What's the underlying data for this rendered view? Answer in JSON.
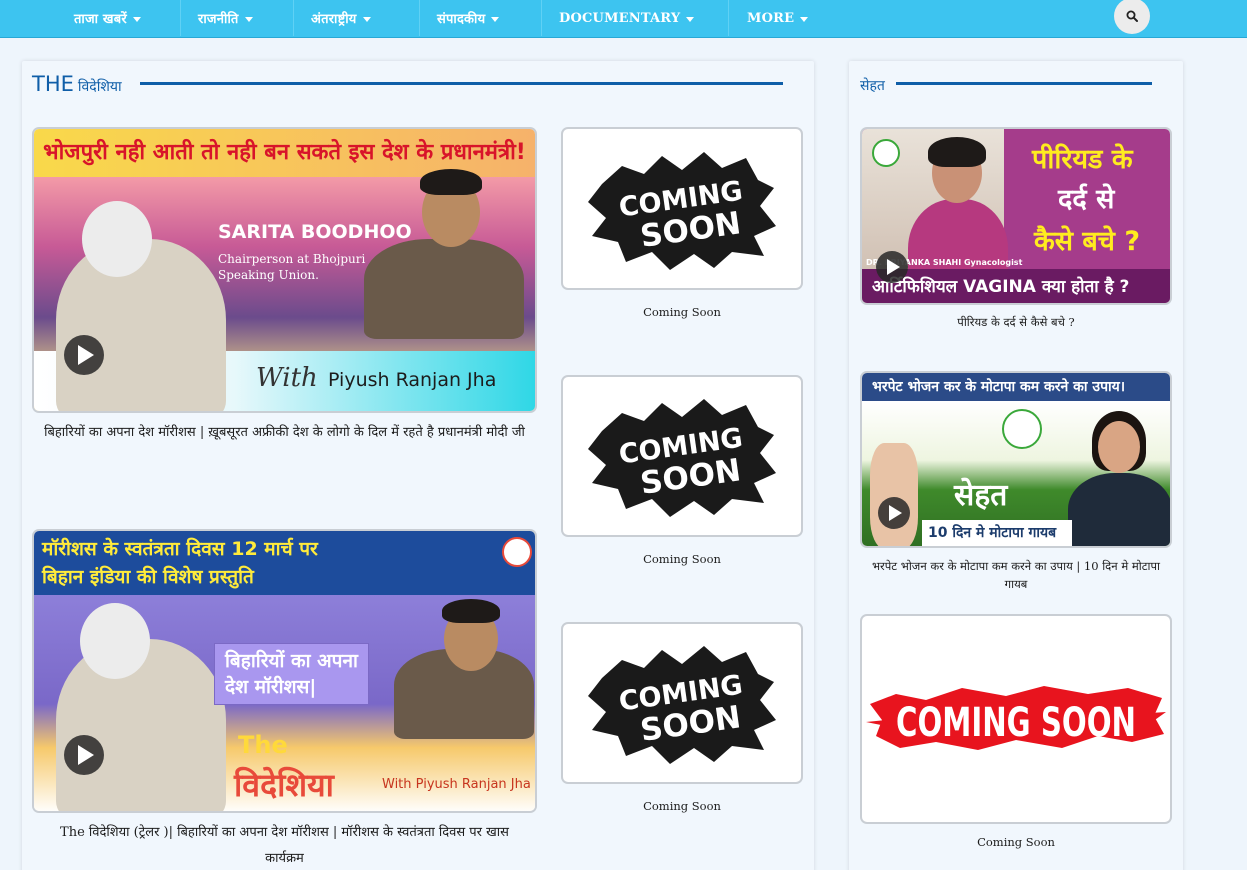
{
  "nav": {
    "items": [
      {
        "label": "ताजा खबरें"
      },
      {
        "label": "राजनीति"
      },
      {
        "label": "अंतराष्ट्रीय"
      },
      {
        "label": "संपादकीय"
      },
      {
        "label": "DOCUMENTARY"
      },
      {
        "label": "MORE"
      }
    ]
  },
  "left_section": {
    "title_big": "THE",
    "title_small": "विदेशिया",
    "main_videos": [
      {
        "caption": "बिहारियों का अपना देश मॉरीशस | ख़ूबसूरत अफ्रीकी देश के लोगो के दिल में रहते है प्रधानमंत्री मोदी जी",
        "thumb": {
          "banner": "भोजपुरी नही आती तो नही बन सकते इस देश के प्रधानमंत्री!",
          "guest_name": "SARITA BOODHOO",
          "guest_role_1": "Chairperson at Bhojpuri",
          "guest_role_2": "Speaking Union.",
          "with": "With",
          "host": "Piyush Ranjan Jha"
        }
      },
      {
        "caption_1": "The विदेशिया (ट्रेलर )| बिहारियों का अपना देश मॉरीशस | मॉरीशस के स्वतंत्रता दिवस पर खास",
        "caption_2": "कार्यक्रम",
        "thumb": {
          "banner_1": "मॉरीशस के स्वतंत्रता दिवस 12 मार्च पर",
          "banner_2": "बिहान इंडिया की विशेष प्रस्तुति",
          "box_1": "बिहारियों का अपना",
          "box_2": "देश मॉरीशस|",
          "the": "The",
          "videshiya": "विदेशिया",
          "host": "With  Piyush Ranjan Jha"
        }
      }
    ],
    "side_videos": [
      {
        "caption": "Coming Soon",
        "art_1": "COMING",
        "art_2": "SOON"
      },
      {
        "caption": "Coming Soon",
        "art_1": "COMING",
        "art_2": "SOON"
      },
      {
        "caption": "Coming Soon",
        "art_1": "COMING",
        "art_2": "SOON"
      }
    ]
  },
  "right_section": {
    "title": "सेहत",
    "videos": [
      {
        "caption": "पीरियड के दर्द से कैसे बचे ?",
        "thumb": {
          "line_1": "पीरियड के",
          "line_2": "दर्द से",
          "line_3": "कैसे बचे ?",
          "doctor": "DR. PRIYANKA SHAHI",
          "doctor_role": "Gynacologist",
          "bottom": "आर्टिफिशियल VAGINA क्या होता है ?"
        }
      },
      {
        "caption": "भरपेट भोजन कर के मोटापा कम करने का उपाय | 10 दिन मे मोटापा गायब",
        "thumb": {
          "top": "भरपेट भोजन कर के मोटापा कम करने का उपाय।",
          "sehat": "सेहत",
          "strip": "10 दिन मे मोटापा गायब"
        }
      },
      {
        "caption": "Coming Soon",
        "art": "COMING SOON"
      }
    ]
  },
  "colors": {
    "nav_bg": "#3dc4f0",
    "accent": "#0f5ea8",
    "page_bg": "#eef5fc"
  }
}
